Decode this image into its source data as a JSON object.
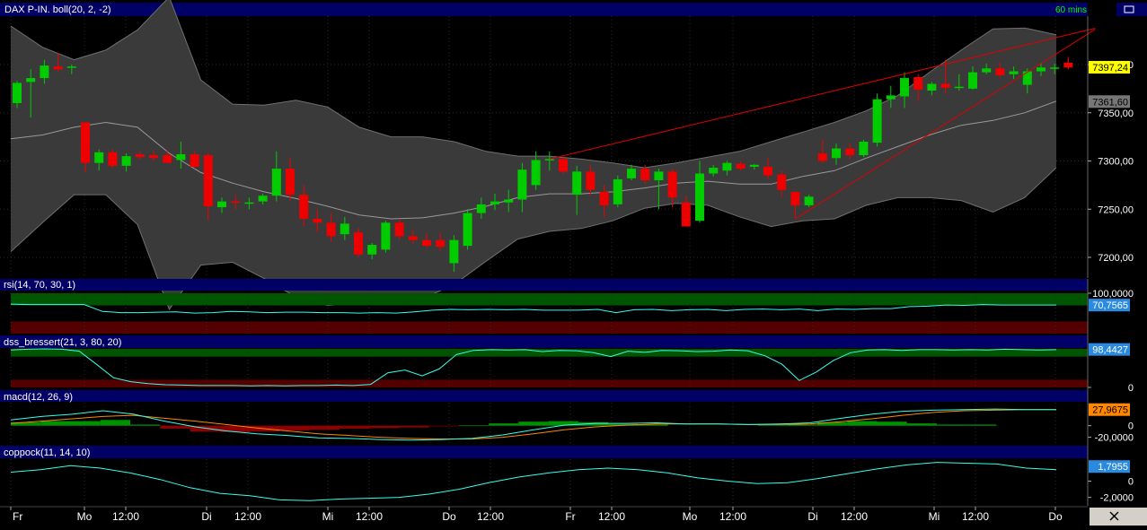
{
  "panels": {
    "main": {
      "label": "DAX P-IN. boll(20, 2, -2)",
      "timeframe": "60 mins"
    },
    "rsi": {
      "label": "rsi(14, 70, 30, 1)"
    },
    "dss": {
      "label": "dss_bressert(21, 3, 80, 20)"
    },
    "macd": {
      "label": "macd(12, 26, 9)"
    },
    "coppock": {
      "label": "coppock(11, 14, 10)"
    }
  },
  "chart_data": {
    "type": "candlestick",
    "instrument": "DAX P-IN.",
    "timeframe": "60 mins",
    "price_axis": {
      "range": [
        7180,
        7440
      ],
      "ticks": [
        "7200,00",
        "7250,00",
        "7300,00",
        "7350,00",
        "7400,00"
      ],
      "last_price": "7397,24",
      "band_marker": "7361,60"
    },
    "time_axis": {
      "labels": [
        "Fr",
        "Mo",
        "12:00",
        "Di",
        "12:00",
        "Mi",
        "12:00",
        "Do",
        "12:00",
        "Fr",
        "12:00",
        "Mo",
        "12:00",
        "Di",
        "12:00",
        "Mi",
        "12:00",
        "Do"
      ]
    },
    "candles": [
      {
        "o": 7360,
        "h": 7383,
        "l": 7355,
        "c": 7381
      },
      {
        "o": 7382,
        "h": 7395,
        "l": 7345,
        "c": 7386
      },
      {
        "o": 7386,
        "h": 7405,
        "l": 7380,
        "c": 7399
      },
      {
        "o": 7398,
        "h": 7412,
        "l": 7393,
        "c": 7395
      },
      {
        "o": 7398,
        "h": 7400,
        "l": 7390,
        "c": 7398
      },
      {
        "o": 7340,
        "h": 7340,
        "l": 7288,
        "c": 7298
      },
      {
        "o": 7298,
        "h": 7312,
        "l": 7290,
        "c": 7309
      },
      {
        "o": 7309,
        "h": 7312,
        "l": 7293,
        "c": 7295
      },
      {
        "o": 7295,
        "h": 7308,
        "l": 7289,
        "c": 7305
      },
      {
        "o": 7307,
        "h": 7310,
        "l": 7302,
        "c": 7304
      },
      {
        "o": 7306,
        "h": 7310,
        "l": 7300,
        "c": 7303
      },
      {
        "o": 7306,
        "h": 7311,
        "l": 7300,
        "c": 7298
      },
      {
        "o": 7301,
        "h": 7320,
        "l": 7292,
        "c": 7307
      },
      {
        "o": 7307,
        "h": 7310,
        "l": 7292,
        "c": 7294
      },
      {
        "o": 7306,
        "h": 7308,
        "l": 7238,
        "c": 7253
      },
      {
        "o": 7252,
        "h": 7262,
        "l": 7246,
        "c": 7258
      },
      {
        "o": 7258,
        "h": 7265,
        "l": 7250,
        "c": 7257
      },
      {
        "o": 7256,
        "h": 7262,
        "l": 7250,
        "c": 7257
      },
      {
        "o": 7258,
        "h": 7266,
        "l": 7255,
        "c": 7264
      },
      {
        "o": 7264,
        "h": 7310,
        "l": 7258,
        "c": 7292
      },
      {
        "o": 7292,
        "h": 7303,
        "l": 7258,
        "c": 7265
      },
      {
        "o": 7265,
        "h": 7275,
        "l": 7232,
        "c": 7240
      },
      {
        "o": 7240,
        "h": 7250,
        "l": 7226,
        "c": 7236
      },
      {
        "o": 7236,
        "h": 7246,
        "l": 7216,
        "c": 7222
      },
      {
        "o": 7224,
        "h": 7242,
        "l": 7218,
        "c": 7235
      },
      {
        "o": 7226,
        "h": 7230,
        "l": 7200,
        "c": 7203
      },
      {
        "o": 7203,
        "h": 7215,
        "l": 7198,
        "c": 7213
      },
      {
        "o": 7208,
        "h": 7238,
        "l": 7205,
        "c": 7236
      },
      {
        "o": 7236,
        "h": 7240,
        "l": 7218,
        "c": 7222
      },
      {
        "o": 7222,
        "h": 7228,
        "l": 7214,
        "c": 7218
      },
      {
        "o": 7218,
        "h": 7225,
        "l": 7210,
        "c": 7212
      },
      {
        "o": 7218,
        "h": 7226,
        "l": 7207,
        "c": 7211
      },
      {
        "o": 7194,
        "h": 7223,
        "l": 7185,
        "c": 7218
      },
      {
        "o": 7212,
        "h": 7250,
        "l": 7208,
        "c": 7246
      },
      {
        "o": 7246,
        "h": 7262,
        "l": 7240,
        "c": 7255
      },
      {
        "o": 7255,
        "h": 7266,
        "l": 7249,
        "c": 7258
      },
      {
        "o": 7257,
        "h": 7270,
        "l": 7247,
        "c": 7260
      },
      {
        "o": 7260,
        "h": 7298,
        "l": 7247,
        "c": 7291
      },
      {
        "o": 7275,
        "h": 7310,
        "l": 7270,
        "c": 7301
      },
      {
        "o": 7301,
        "h": 7310,
        "l": 7290,
        "c": 7302
      },
      {
        "o": 7302,
        "h": 7305,
        "l": 7287,
        "c": 7289
      },
      {
        "o": 7265,
        "h": 7295,
        "l": 7244,
        "c": 7289
      },
      {
        "o": 7289,
        "h": 7296,
        "l": 7264,
        "c": 7270
      },
      {
        "o": 7268,
        "h": 7275,
        "l": 7242,
        "c": 7254
      },
      {
        "o": 7255,
        "h": 7285,
        "l": 7252,
        "c": 7281
      },
      {
        "o": 7282,
        "h": 7296,
        "l": 7280,
        "c": 7292
      },
      {
        "o": 7292,
        "h": 7296,
        "l": 7276,
        "c": 7280
      },
      {
        "o": 7280,
        "h": 7292,
        "l": 7250,
        "c": 7289
      },
      {
        "o": 7289,
        "h": 7292,
        "l": 7252,
        "c": 7262
      },
      {
        "o": 7257,
        "h": 7264,
        "l": 7235,
        "c": 7232
      },
      {
        "o": 7238,
        "h": 7300,
        "l": 7236,
        "c": 7287
      },
      {
        "o": 7287,
        "h": 7296,
        "l": 7284,
        "c": 7293
      },
      {
        "o": 7290,
        "h": 7300,
        "l": 7285,
        "c": 7298
      },
      {
        "o": 7297,
        "h": 7300,
        "l": 7290,
        "c": 7292
      },
      {
        "o": 7294,
        "h": 7297,
        "l": 7291,
        "c": 7296
      },
      {
        "o": 7294,
        "h": 7303,
        "l": 7281,
        "c": 7285
      },
      {
        "o": 7286,
        "h": 7290,
        "l": 7263,
        "c": 7270
      },
      {
        "o": 7268,
        "h": 7268,
        "l": 7240,
        "c": 7254
      },
      {
        "o": 7254,
        "h": 7265,
        "l": 7252,
        "c": 7263
      },
      {
        "o": 7308,
        "h": 7322,
        "l": 7298,
        "c": 7300
      },
      {
        "o": 7303,
        "h": 7318,
        "l": 7296,
        "c": 7313
      },
      {
        "o": 7313,
        "h": 7318,
        "l": 7302,
        "c": 7306
      },
      {
        "o": 7306,
        "h": 7322,
        "l": 7304,
        "c": 7320
      },
      {
        "o": 7319,
        "h": 7370,
        "l": 7315,
        "c": 7364
      },
      {
        "o": 7364,
        "h": 7378,
        "l": 7355,
        "c": 7368
      },
      {
        "o": 7367,
        "h": 7392,
        "l": 7355,
        "c": 7386
      },
      {
        "o": 7387,
        "h": 7390,
        "l": 7362,
        "c": 7374
      },
      {
        "o": 7373,
        "h": 7382,
        "l": 7368,
        "c": 7380
      },
      {
        "o": 7380,
        "h": 7405,
        "l": 7370,
        "c": 7376
      },
      {
        "o": 7376,
        "h": 7390,
        "l": 7373,
        "c": 7377
      },
      {
        "o": 7375,
        "h": 7398,
        "l": 7374,
        "c": 7392
      },
      {
        "o": 7392,
        "h": 7401,
        "l": 7390,
        "c": 7396
      },
      {
        "o": 7396,
        "h": 7402,
        "l": 7386,
        "c": 7389
      },
      {
        "o": 7390,
        "h": 7398,
        "l": 7385,
        "c": 7393
      },
      {
        "o": 7379,
        "h": 7396,
        "l": 7370,
        "c": 7393
      },
      {
        "o": 7393,
        "h": 7402,
        "l": 7388,
        "c": 7397
      },
      {
        "o": 7396,
        "h": 7401,
        "l": 7390,
        "c": 7397
      },
      {
        "o": 7402,
        "h": 7408,
        "l": 7395,
        "c": 7397
      }
    ],
    "bollinger": {
      "upper": [
        7440,
        7418,
        7405,
        7415,
        7436,
        7470,
        7384,
        7359,
        7358,
        7363,
        7356,
        7335,
        7325,
        7325,
        7320,
        7310,
        7305,
        7305,
        7302,
        7298,
        7293,
        7298,
        7304,
        7310,
        7320,
        7330,
        7340,
        7352,
        7368,
        7392,
        7415,
        7437,
        7438,
        7431
      ],
      "middle": [
        7323,
        7327,
        7335,
        7340,
        7335,
        7308,
        7288,
        7277,
        7268,
        7261,
        7253,
        7244,
        7240,
        7241,
        7246,
        7253,
        7262,
        7266,
        7266,
        7268,
        7272,
        7277,
        7279,
        7276,
        7276,
        7284,
        7290,
        7303,
        7315,
        7327,
        7337,
        7342,
        7350,
        7362
      ],
      "lower": [
        7206,
        7236,
        7265,
        7265,
        7234,
        7146,
        7192,
        7195,
        7178,
        7159,
        7150,
        7153,
        7155,
        7157,
        7172,
        7196,
        7219,
        7227,
        7230,
        7238,
        7251,
        7256,
        7254,
        7242,
        7232,
        7238,
        7240,
        7254,
        7262,
        7262,
        7259,
        7247,
        7262,
        7293
      ]
    },
    "trendlines": [
      {
        "from": {
          "bar": 39,
          "price": 7302
        },
        "to": {
          "bar": 77,
          "price": 7431
        }
      },
      {
        "from": {
          "bar": 57,
          "price": 7240
        },
        "to": {
          "bar": 77,
          "price": 7419
        }
      }
    ],
    "indicators": {
      "rsi": {
        "params": "14, 70, 30, 1",
        "last_value": "70,7565",
        "ticks": [
          "100,0000"
        ],
        "zones": {
          "overbought": 70,
          "oversold": 30
        },
        "range": [
          0,
          100
        ],
        "values": [
          73,
          72,
          72,
          72,
          72,
          55,
          52,
          52,
          53,
          54,
          51,
          52,
          55,
          54,
          52,
          53,
          53,
          52,
          52,
          51,
          52,
          51,
          54,
          58,
          60,
          59,
          60,
          59,
          60,
          58,
          58,
          58,
          60,
          52,
          59,
          60,
          57,
          59,
          60,
          57,
          60,
          61,
          59,
          61,
          57,
          61,
          60,
          62,
          62,
          67,
          68,
          71,
          70,
          72,
          71,
          71,
          71,
          71
        ]
      },
      "dss_bressert": {
        "params": "21, 3, 80, 20",
        "last_value": "98,4427",
        "ticks": [
          "0"
        ],
        "zones": {
          "overbought": 80,
          "oversold": 20
        },
        "range": [
          0,
          100
        ],
        "values": [
          97,
          99,
          100,
          99,
          94,
          60,
          25,
          15,
          10,
          7,
          6,
          5,
          5,
          5,
          4,
          5,
          4,
          5,
          5,
          6,
          5,
          8,
          38,
          45,
          30,
          48,
          85,
          96,
          98,
          97,
          98,
          93,
          96,
          95,
          90,
          80,
          94,
          91,
          96,
          95,
          93,
          94,
          97,
          95,
          82,
          60,
          18,
          40,
          70,
          90,
          97,
          98,
          96,
          98,
          98,
          97,
          98,
          97,
          99,
          98,
          97,
          98
        ]
      },
      "macd": {
        "params": "12, 26, 9",
        "last_value": "27,9675",
        "ticks": [
          "0",
          "-20,0000"
        ],
        "range": [
          -30,
          40
        ],
        "macd_line": [
          10,
          16,
          20,
          26,
          20,
          8,
          -2,
          -9,
          -14,
          -17,
          -21,
          -22,
          -24,
          -25,
          -24,
          -22,
          -16,
          -7,
          1,
          4,
          4,
          5,
          3,
          3,
          2,
          3,
          5,
          13,
          20,
          25,
          27,
          28,
          29,
          28,
          28
        ],
        "signal_line": [
          4,
          8,
          12,
          16,
          18,
          13,
          8,
          2,
          -4,
          -9,
          -14,
          -17,
          -20,
          -22,
          -23,
          -23,
          -20,
          -14,
          -7,
          -2,
          1,
          3,
          3,
          3,
          2,
          2,
          3,
          7,
          12,
          18,
          23,
          26,
          27,
          28,
          28
        ],
        "histogram": [
          6,
          8,
          8,
          10,
          2,
          -5,
          -10,
          -11,
          -10,
          -8,
          -7,
          -5,
          -4,
          -3,
          -1,
          1,
          4,
          7,
          8,
          6,
          3,
          2,
          0,
          0,
          0,
          1,
          2,
          6,
          8,
          7,
          4,
          2,
          2,
          0,
          0
        ]
      },
      "coppock": {
        "params": "11, 14, 10",
        "last_value": "1,7955",
        "ticks": [
          "0",
          "-2,0000"
        ],
        "range": [
          -2.7,
          2.7
        ],
        "values": [
          1.1,
          1.4,
          1.9,
          1.6,
          1.0,
          0.2,
          -0.8,
          -1.5,
          -1.8,
          -2.3,
          -2.4,
          -2.2,
          -2.1,
          -2.0,
          -1.6,
          -1.0,
          -0.2,
          0.5,
          1.0,
          1.4,
          1.6,
          1.4,
          1.0,
          0.4,
          0.0,
          -0.3,
          -0.2,
          0.3,
          0.9,
          1.5,
          2.0,
          2.3,
          2.2,
          2.1,
          1.6,
          1.4
        ]
      }
    }
  },
  "colors": {
    "background": "#000000",
    "header_bar": "#000066",
    "band_fill": "#3a3a3a",
    "band_edge": "#707070",
    "bull": "#00cc00",
    "bear": "#ee0000",
    "trendline": "#dd0000",
    "indicator_line": "#33ffee",
    "overbought_zone": "#005500",
    "oversold_zone": "#550000",
    "text": "#ffffff",
    "timeframe_text": "#00ff00",
    "price_badge": "#ffff00",
    "marker_badge": "#777777",
    "rsi_badge": "#2a8adf",
    "macd_badge": "#ff8800",
    "macd_line": "#33ffee",
    "signal_line": "#ff8800",
    "histogram_pos": "#00aa00",
    "histogram_neg": "#aa0000"
  }
}
